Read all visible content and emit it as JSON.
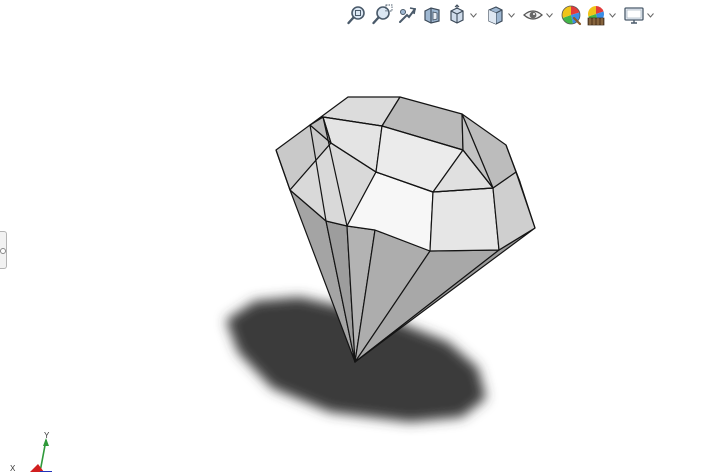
{
  "viewport": {
    "background": "#ffffff"
  },
  "heads_up_toolbar": {
    "items": [
      {
        "name": "zoom-to-fit-icon"
      },
      {
        "name": "zoom-to-area-icon"
      },
      {
        "name": "previous-view-icon"
      },
      {
        "name": "section-view-icon"
      },
      {
        "name": "view-orientation-icon",
        "has_dropdown": true
      },
      {
        "name": "display-style-icon",
        "has_dropdown": true
      },
      {
        "name": "hide-show-items-icon",
        "has_dropdown": true
      },
      {
        "name": "edit-appearance-icon"
      },
      {
        "name": "apply-scene-icon",
        "has_dropdown": true
      },
      {
        "name": "view-settings-icon",
        "has_dropdown": true
      }
    ]
  },
  "model": {
    "name": "diamond-gem-part",
    "colors": {
      "face_light": "#f7f7f7",
      "face_mid": "#e3e3e3",
      "face_dark": "#bdbdbd",
      "pavilion": "#a7a7a7",
      "edge": "#141414",
      "shadow": "#3b3b3b"
    }
  },
  "triad": {
    "axis_labels": {
      "y": "Y",
      "x": "X"
    },
    "colors": {
      "y": "#2f9a3a",
      "x": "#d11f1f",
      "z": "#2233bb"
    }
  }
}
